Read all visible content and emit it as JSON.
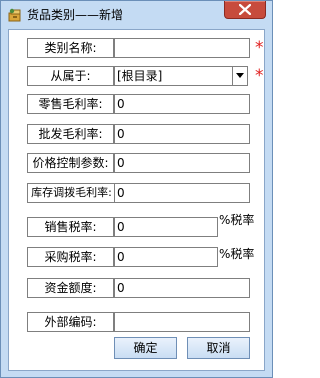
{
  "window": {
    "title": "货品类别——新增"
  },
  "form": {
    "category_name": {
      "label": "类别名称:",
      "value": "",
      "required": "*"
    },
    "parent": {
      "label": "从属于:",
      "value": "[根目录]",
      "required": "*"
    },
    "retail_margin": {
      "label": "零售毛利率:",
      "value": "0"
    },
    "wholesale_margin": {
      "label": "批发毛利率:",
      "value": "0"
    },
    "price_control": {
      "label": "价格控制参数:",
      "value": "0"
    },
    "transfer_margin": {
      "label": "库存调拨毛利率:",
      "value": "0"
    },
    "sales_tax": {
      "label": "销售税率:",
      "value": "0",
      "unit": "%税率"
    },
    "purchase_tax": {
      "label": "采购税率:",
      "value": "0",
      "unit": "%税率"
    },
    "fund_amount": {
      "label": "资金额度:",
      "value": "0"
    },
    "external_code": {
      "label": "外部编码:",
      "value": ""
    }
  },
  "buttons": {
    "ok": "确定",
    "cancel": "取消"
  },
  "icons": {
    "app": "goods-category-icon",
    "close": "close-icon",
    "dropdown": "chevron-down-icon"
  },
  "colors": {
    "frame": "#c4dbf3",
    "close_button": "#c74b3c",
    "required": "#e02020"
  }
}
